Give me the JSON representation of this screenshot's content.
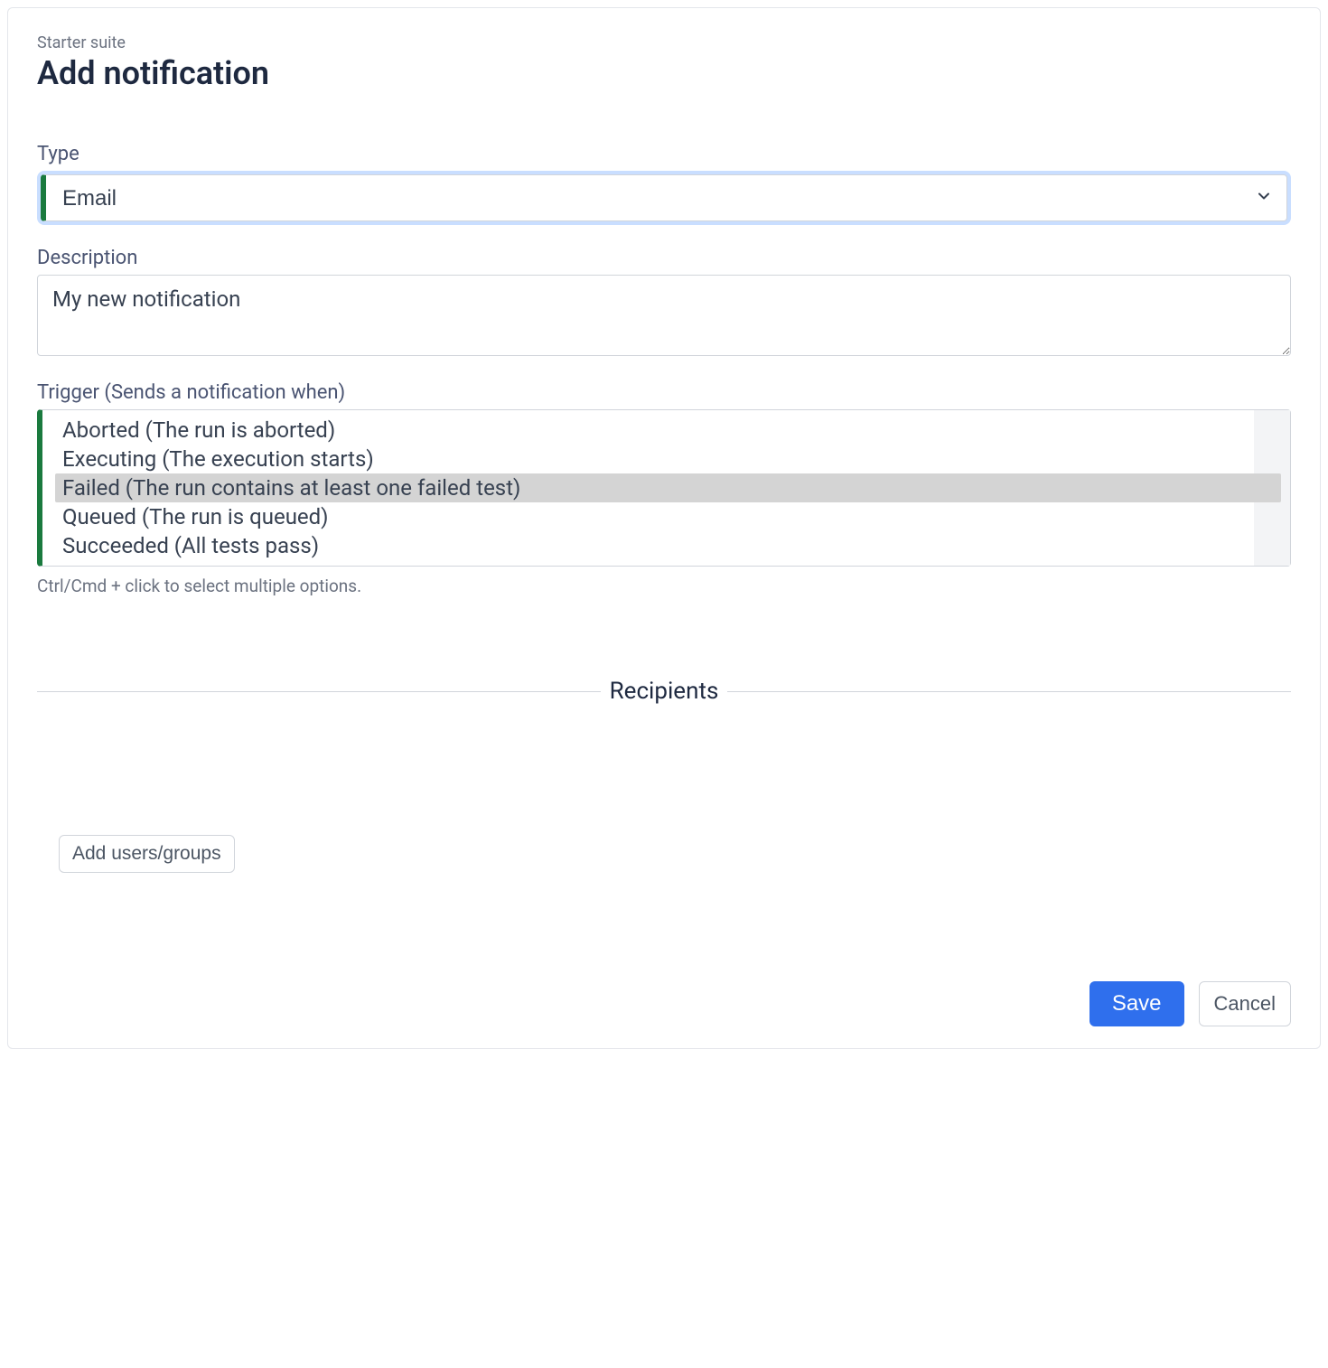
{
  "header": {
    "breadcrumb": "Starter suite",
    "title": "Add notification"
  },
  "form": {
    "type": {
      "label": "Type",
      "value": "Email"
    },
    "description": {
      "label": "Description",
      "value": "My new notification"
    },
    "trigger": {
      "label": "Trigger (Sends a notification when)",
      "options": [
        {
          "text": "Aborted (The run is aborted)",
          "selected": false
        },
        {
          "text": "Executing (The execution starts)",
          "selected": false
        },
        {
          "text": "Failed (The run contains at least one failed test)",
          "selected": true
        },
        {
          "text": "Queued (The run is queued)",
          "selected": false
        },
        {
          "text": "Succeeded (All tests pass)",
          "selected": false
        }
      ],
      "helper": "Ctrl/Cmd + click to select multiple options."
    }
  },
  "recipients": {
    "heading": "Recipients",
    "add_button": "Add users/groups"
  },
  "actions": {
    "save": "Save",
    "cancel": "Cancel"
  }
}
